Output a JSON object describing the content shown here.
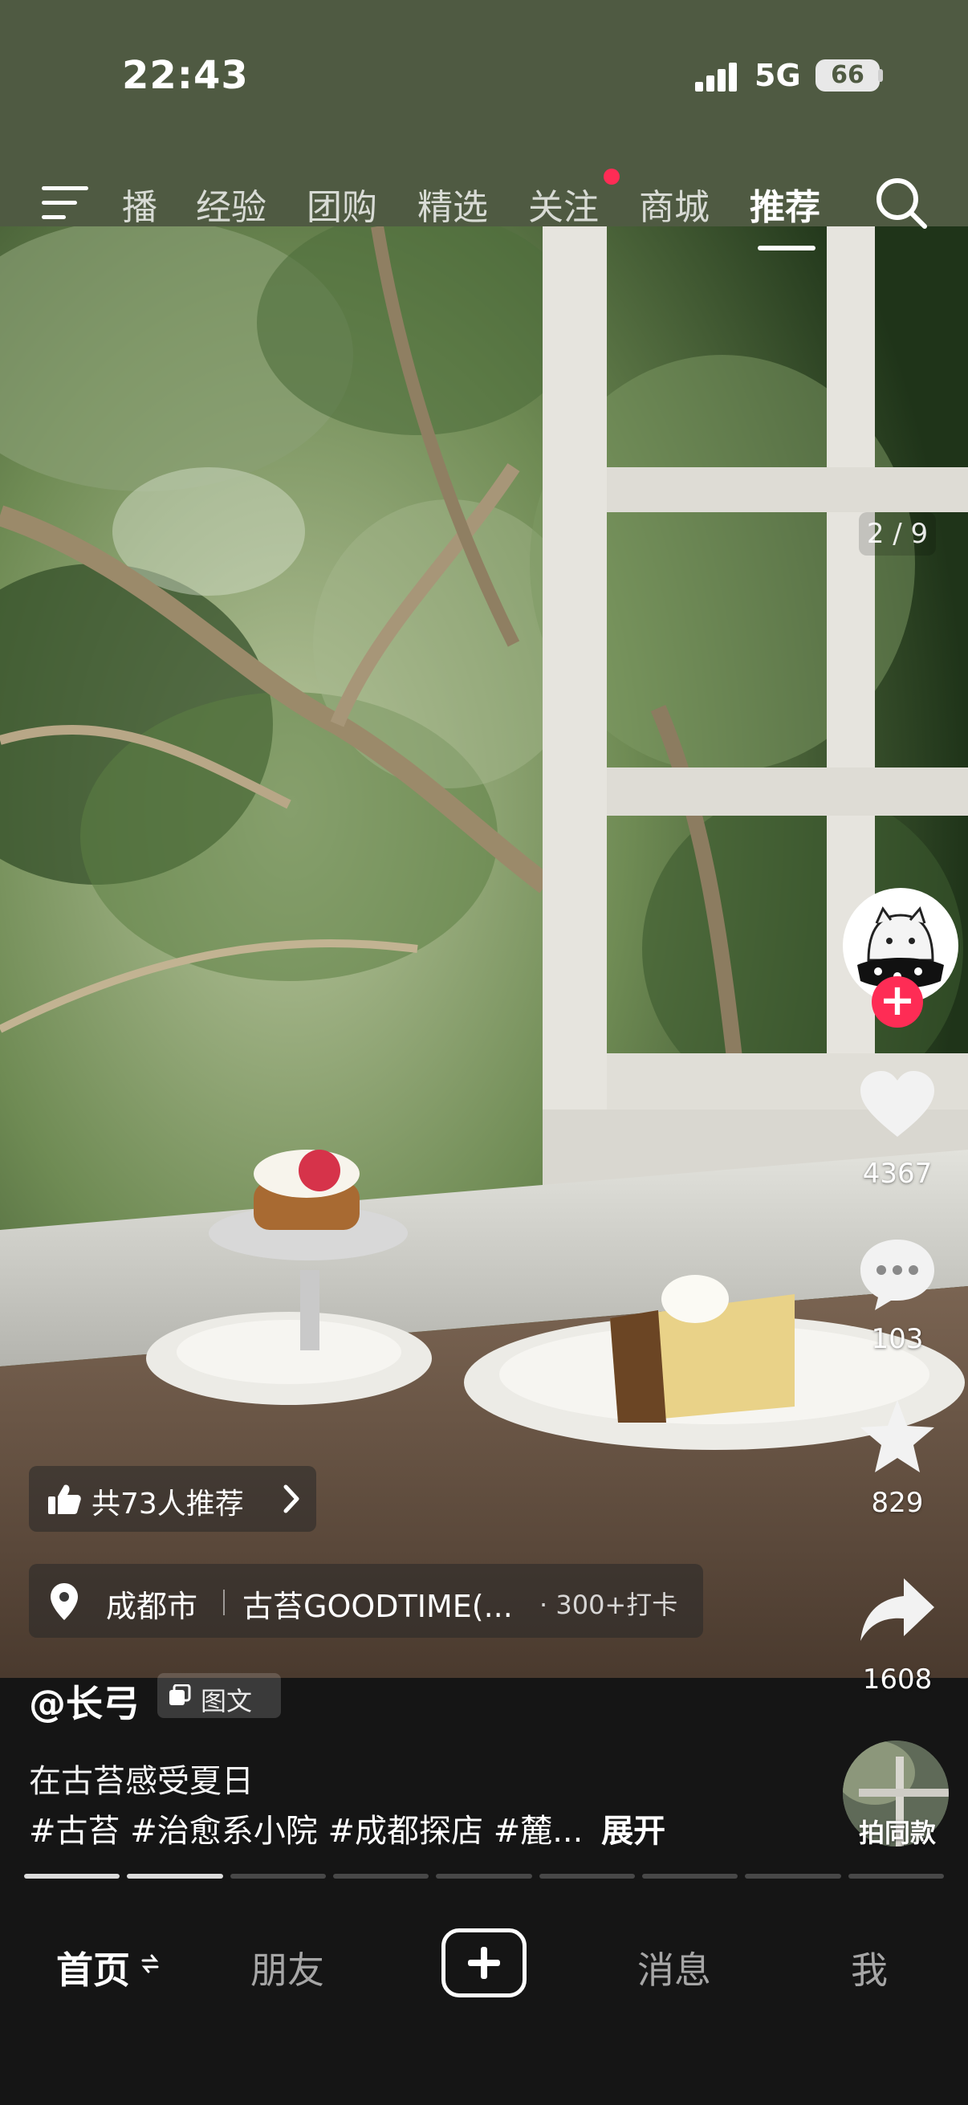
{
  "status_bar": {
    "time": "22:43",
    "network": "5G",
    "battery": "66"
  },
  "top_nav": {
    "tabs": [
      {
        "label": "播"
      },
      {
        "label": "经验"
      },
      {
        "label": "团购"
      },
      {
        "label": "精选"
      },
      {
        "label": "关注"
      },
      {
        "label": "商城"
      },
      {
        "label": "推荐"
      }
    ],
    "active_tab": "推荐"
  },
  "post": {
    "page_counter": "2 / 9",
    "recommend": "共73人推荐",
    "location": {
      "city": "成都市",
      "shop": "古苔GOODTIME(...",
      "checkins": "· 300+打卡"
    },
    "author": "@长弓",
    "type_badge": "图文",
    "caption": "在古苔感受夏日",
    "tags": "#古苔 #治愈系小院 #成都探店 #麓...",
    "expand": "展开",
    "likes": "4367",
    "comments": "103",
    "favorites": "829",
    "shares": "1608",
    "same_style": "拍同款",
    "progress": {
      "total": 9,
      "current": 2
    }
  },
  "bottom_nav": {
    "home": "首页",
    "friends": "朋友",
    "messages": "消息",
    "me": "我"
  },
  "colors": {
    "accent": "#fe2c55",
    "top_band": "#4f5a42",
    "nav_bg": "#151515"
  }
}
